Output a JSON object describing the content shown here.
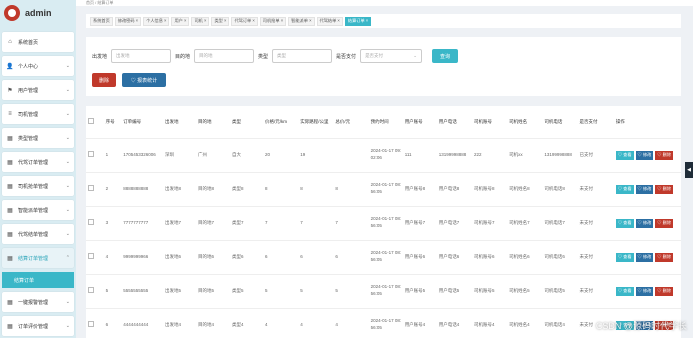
{
  "app": {
    "name": "admin"
  },
  "sidebar": {
    "items": [
      {
        "icon": "⌂",
        "label": "系统首页",
        "chevron": ""
      },
      {
        "icon": "👤",
        "label": "个人中心",
        "chevron": "⌄"
      },
      {
        "icon": "⚑",
        "label": "用户管理",
        "chevron": "⌄"
      },
      {
        "icon": "≡",
        "label": "司机管理",
        "chevron": "⌄"
      },
      {
        "icon": "▦",
        "label": "类型管理",
        "chevron": "⌄"
      },
      {
        "icon": "▦",
        "label": "代驾订单管理",
        "chevron": "⌄"
      },
      {
        "icon": "▦",
        "label": "司机抢单管理",
        "chevron": "⌄"
      },
      {
        "icon": "▦",
        "label": "智能派单管理",
        "chevron": "⌄"
      },
      {
        "icon": "▦",
        "label": "代驾结单管理",
        "chevron": "⌄"
      },
      {
        "icon": "▦",
        "label": "结算订单管理",
        "chevron": "⌃"
      },
      {
        "icon": "▦",
        "label": "一键报警管理",
        "chevron": "⌄"
      },
      {
        "icon": "▦",
        "label": "订单评价管理",
        "chevron": "⌄"
      }
    ],
    "submenu_label": "结算订单"
  },
  "topbar": {
    "crumb": "首页 / 结算订单"
  },
  "tabs": [
    {
      "label": "系统首页",
      "active": false
    },
    {
      "label": "修改密码 ×",
      "active": false
    },
    {
      "label": "个人信息 ×",
      "active": false
    },
    {
      "label": "用户 ×",
      "active": false
    },
    {
      "label": "司机 ×",
      "active": false
    },
    {
      "label": "类型 ×",
      "active": false
    },
    {
      "label": "代驾订单 ×",
      "active": false
    },
    {
      "label": "司机抢单 ×",
      "active": false
    },
    {
      "label": "智能派单 ×",
      "active": false
    },
    {
      "label": "代驾结单 ×",
      "active": false
    },
    {
      "label": "结算订单 ×",
      "active": true
    }
  ],
  "search": {
    "fields": [
      {
        "label": "出发地",
        "placeholder": "出发地"
      },
      {
        "label": "目的地",
        "placeholder": "目的地"
      },
      {
        "label": "类型",
        "placeholder": "类型"
      }
    ],
    "select": {
      "label": "是否支付",
      "placeholder": "是否支付"
    },
    "search_button": "查询",
    "delete_button": "删除",
    "stat_button": "♡ 报表统计"
  },
  "table": {
    "headers": [
      "",
      "序号",
      "订单编号",
      "出发地",
      "目的地",
      "类型",
      "价格/元/km",
      "实际路程/公里",
      "总价/元",
      "预约时间",
      "用户账号",
      "用户电话",
      "司机账号",
      "司机姓名",
      "司机电话",
      "是否支付",
      "操作"
    ],
    "rows": [
      [
        "1",
        "1705453326006",
        "深圳",
        "广州",
        "自大",
        "20",
        "19",
        "",
        "2024-01-17 09:02:06",
        "111",
        "13199998888",
        "222",
        "司机xx",
        "13199998888",
        "已支付"
      ],
      [
        "2",
        "8888888888",
        "出发地8",
        "目的地8",
        "类型8",
        "8",
        "8",
        "8",
        "2024-01-17 08:56:05",
        "用户账号8",
        "用户电话8",
        "司机账号8",
        "司机姓名8",
        "司机电话8",
        "未支付"
      ],
      [
        "3",
        "7777777777",
        "出发地7",
        "目的地7",
        "类型7",
        "7",
        "7",
        "7",
        "2024-01-17 08:56:05",
        "用户账号7",
        "用户电话7",
        "司机账号7",
        "司机姓名7",
        "司机电话7",
        "未支付"
      ],
      [
        "4",
        "9999999966",
        "出发地6",
        "目的地6",
        "类型6",
        "6",
        "6",
        "6",
        "2024-01-17 08:56:05",
        "用户账号6",
        "用户电话6",
        "司机账号6",
        "司机姓名6",
        "司机电话6",
        "未支付"
      ],
      [
        "5",
        "5555555555",
        "出发地5",
        "目的地5",
        "类型5",
        "5",
        "5",
        "5",
        "2024-01-17 08:56:05",
        "用户账号5",
        "用户电话5",
        "司机账号5",
        "司机姓名5",
        "司机电话5",
        "未支付"
      ],
      [
        "6",
        "4444444444",
        "出发地4",
        "目的地4",
        "类型4",
        "4",
        "4",
        "4",
        "2024-01-17 08:56:05",
        "用户账号4",
        "用户电话4",
        "司机账号4",
        "司机姓名4",
        "司机电话4",
        "未支付"
      ]
    ],
    "ops": {
      "view": "♡ 查看",
      "edit": "♡ 修改",
      "delete": "♡ 删除"
    }
  },
  "watermark": "CSDN @源码时代学长",
  "side_arrow": "◀"
}
